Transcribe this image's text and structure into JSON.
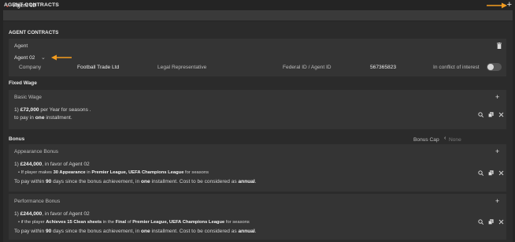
{
  "top": {
    "title": "AGENT CONTRACTS",
    "add_symbol": "+"
  },
  "agent_bar": {
    "label": "Agent 02"
  },
  "section": {
    "title": "AGENT CONTRACTS"
  },
  "agent_card": {
    "heading": "Agent",
    "selected_agent": "Agent 02",
    "company_label": "Company",
    "company_value": "Football Trade Ltd",
    "legal_representative": "Legal Representative",
    "federal_id_label": "Federal ID / Agent ID",
    "federal_id_value": "567365823",
    "conflict_label": "In conflict of interest",
    "conflict_of_interest": false
  },
  "fixed_wage": {
    "title": "Fixed Wage",
    "card_title": "Basic Wage",
    "index": "1)",
    "amount": "£72,000",
    "period_text": "per Year for seasons .",
    "pay_prefix": "to pay in",
    "installments": "one",
    "pay_suffix": "installment."
  },
  "bonus": {
    "title": "Bonus",
    "cap_label": "Bonus Cap",
    "cap_value": "None",
    "appearance": {
      "card_title": "Appearance Bonus",
      "index": "1)",
      "amount": "£244,000",
      "favor_text": ", in favor of Agent 02",
      "cond_prefix": "If player makes",
      "cond_value": "30 Appearance",
      "cond_in": "in",
      "competitions": "Premier League, UEFA Champions League",
      "cond_suffix": "for seasons",
      "pay_prefix": "To pay within",
      "days": "90",
      "pay_mid": "days since the bonus achievement, in",
      "installments": "one",
      "pay_mid2": "installment. Cost to be considered as",
      "cost_type": "annual",
      "pay_end": "."
    },
    "performance": {
      "card_title": "Performance Bonus",
      "index": "1)",
      "amount": "£244,000",
      "favor_text": ", in favor of Agent 02",
      "cond_prefix": "if the player",
      "cond_value": "Achieves 15 Clean sheets",
      "cond_in": "in the",
      "stage": "Final",
      "cond_of": "of",
      "competitions": "Premier League, UEFA Champions League",
      "cond_suffix": "for seasons",
      "pay_prefix": "To pay within",
      "days": "90",
      "pay_mid": "days since the bonus achievement, in",
      "installments": "one",
      "pay_mid2": "installment. Cost to be considered as",
      "cost_type": "annual",
      "pay_end": "."
    }
  },
  "icons": {
    "add": "plus-icon",
    "delete": "trash-icon",
    "search": "search-icon",
    "copy": "copy-icon",
    "close": "close-icon",
    "accent": "#f39c1f",
    "chevron_color": "#e04a3a"
  }
}
